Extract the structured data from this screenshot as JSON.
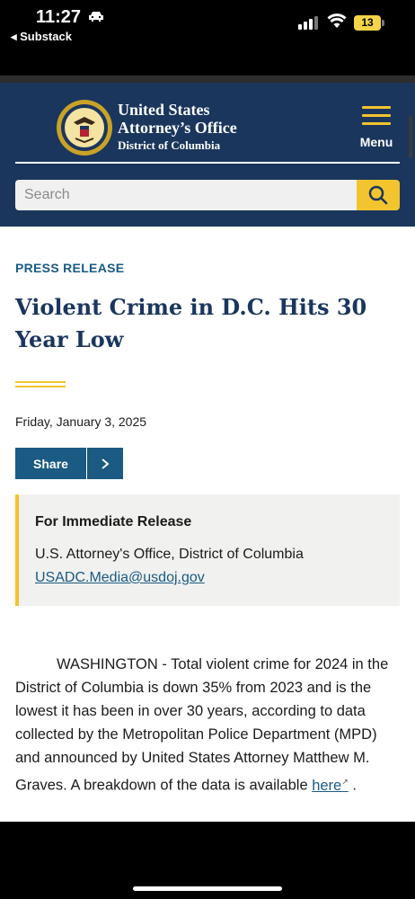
{
  "status_bar": {
    "time": "11:27",
    "back_app": "◂ Substack",
    "battery": "13"
  },
  "header": {
    "agency_line1": "United States",
    "agency_line2": "Attorney’s Office",
    "agency_line3": "District of Columbia",
    "menu_label": "Menu",
    "accent_color": "#f2c42e",
    "brand_color": "#1b365d"
  },
  "search": {
    "placeholder": "Search",
    "value": ""
  },
  "article": {
    "eyebrow": "PRESS RELEASE",
    "title": "Violent Crime in D.C. Hits 30 Year Low",
    "date": "Friday, January 3, 2025",
    "share_label": "Share",
    "release_heading": "For Immediate Release",
    "release_org": "U.S. Attorney's Office, District of Columbia",
    "release_email": "USADC.Media@usdoj.gov",
    "body_text": "WASHINGTON - Total violent crime for 2024 in the District of Columbia is down 35% from 2023 and is the lowest it has been in over 30 years, according to data collected by the Metropolitan Police Department (MPD) and announced by United States Attorney Matthew M. Graves. A breakdown of the data is available ",
    "body_link": "here",
    "body_end": " ."
  }
}
